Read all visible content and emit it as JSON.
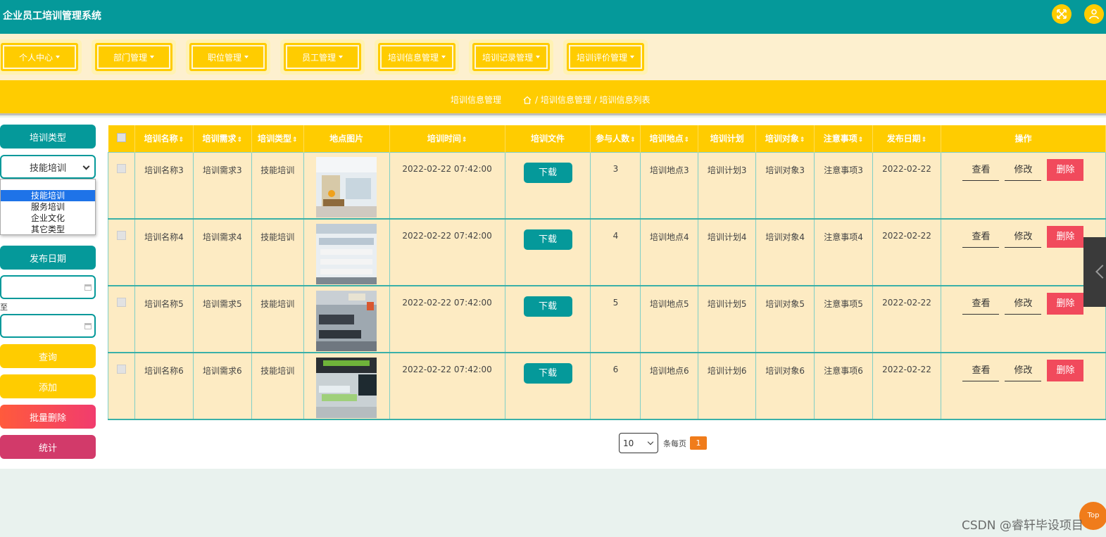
{
  "app": {
    "title": "企业员工培训管理系统"
  },
  "nav": [
    {
      "label": "个人中心"
    },
    {
      "label": "部门管理"
    },
    {
      "label": "职位管理"
    },
    {
      "label": "员工管理"
    },
    {
      "label": "培训信息管理"
    },
    {
      "label": "培训记录管理"
    },
    {
      "label": "培训评价管理"
    }
  ],
  "breadcrumb": {
    "left": "培训信息管理",
    "path": "/ 培训信息管理 / 培训信息列表"
  },
  "sidebar": {
    "type_label": "培训类型",
    "type_selected": "技能培训",
    "type_options": [
      "技能培训",
      "服务培训",
      "企业文化",
      "其它类型"
    ],
    "date_label": "发布日期",
    "buttons": {
      "query": "查询",
      "add": "添加",
      "batch_delete": "批量删除",
      "stats": "统计"
    },
    "stray_char": "至"
  },
  "table": {
    "headers": [
      "培训名称",
      "培训需求",
      "培训类型",
      "地点图片",
      "培训时间",
      "培训文件",
      "参与人数",
      "培训地点",
      "培训计划",
      "培训对象",
      "注意事项",
      "发布日期",
      "操作"
    ],
    "sortable_suffix": "⇕",
    "download_label": "下载",
    "actions": {
      "view": "查看",
      "edit": "修改",
      "delete": "删除"
    },
    "rows": [
      {
        "name": "培训名称3",
        "demand": "培训需求3",
        "type": "技能培训",
        "time": "2022-02-22 07:42:00",
        "count": "3",
        "place": "培训地点3",
        "plan": "培训计划3",
        "target": "培训对象3",
        "notes": "注意事项3",
        "date": "2022-02-22"
      },
      {
        "name": "培训名称4",
        "demand": "培训需求4",
        "type": "技能培训",
        "time": "2022-02-22 07:42:00",
        "count": "4",
        "place": "培训地点4",
        "plan": "培训计划4",
        "target": "培训对象4",
        "notes": "注意事项4",
        "date": "2022-02-22"
      },
      {
        "name": "培训名称5",
        "demand": "培训需求5",
        "type": "技能培训",
        "time": "2022-02-22 07:42:00",
        "count": "5",
        "place": "培训地点5",
        "plan": "培训计划5",
        "target": "培训对象5",
        "notes": "注意事项5",
        "date": "2022-02-22"
      },
      {
        "name": "培训名称6",
        "demand": "培训需求6",
        "type": "技能培训",
        "time": "2022-02-22 07:42:00",
        "count": "6",
        "place": "培训地点6",
        "plan": "培训计划6",
        "target": "培训对象6",
        "notes": "注意事项6",
        "date": "2022-02-22"
      }
    ]
  },
  "pagination": {
    "page_size": "10",
    "per_page_label": "条每页",
    "current_page": "1"
  },
  "misc": {
    "top_label": "Top",
    "watermark": "CSDN @睿轩毕设项目"
  },
  "colors": {
    "teal": "#05999a",
    "yellow": "#ffcc00",
    "cream": "#fdebc3",
    "red": "#f14a5c",
    "orange": "#f07c1b",
    "pink": "#d23a6a"
  }
}
